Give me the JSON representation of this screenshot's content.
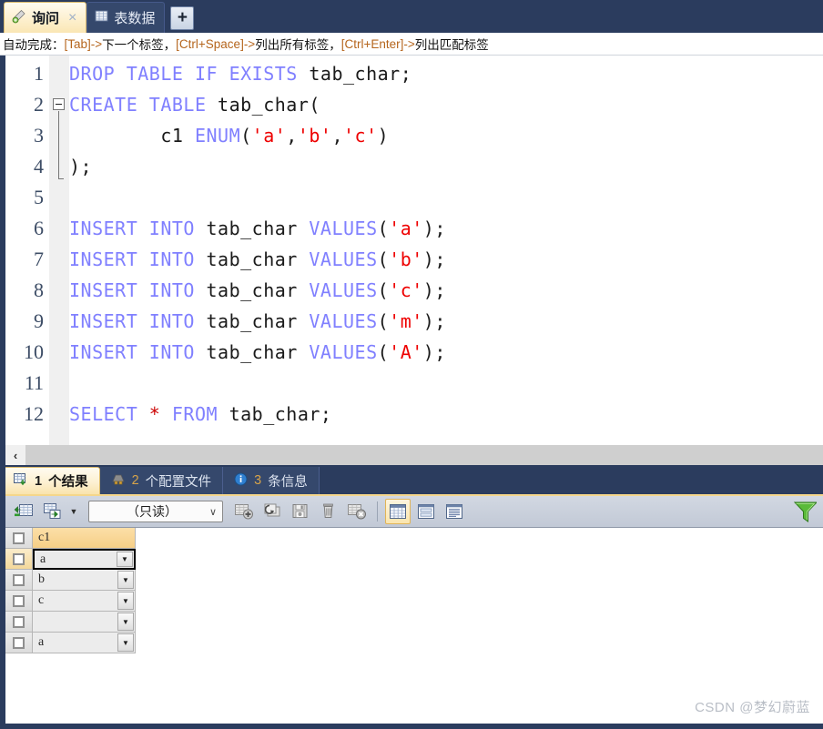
{
  "window": {
    "accent_gold": "#f5d68a",
    "chrome_navy": "#2b3c5e"
  },
  "tabs": [
    {
      "label": "询问",
      "icon": "query-tab-icon",
      "active": true,
      "closable": true,
      "close_glyph": "×"
    },
    {
      "label": "表数据",
      "icon": "table-data-icon",
      "active": false,
      "closable": false
    }
  ],
  "new_tab_button": {
    "label": "+",
    "name": "new-tab-button"
  },
  "hint": {
    "prefix": "自动完成：",
    "items": [
      {
        "key": "[Tab]->",
        "text": " 下一个标签，"
      },
      {
        "key": "[Ctrl+Space]->",
        "text": " 列出所有标签，"
      },
      {
        "key": "[Ctrl+Enter]->",
        "text": " 列出匹配标签"
      }
    ]
  },
  "editor": {
    "lines": [
      {
        "n": "1",
        "tokens": [
          {
            "t": "DROP TABLE IF EXISTS ",
            "c": "kw"
          },
          {
            "t": "tab_char",
            "c": "id"
          },
          {
            "t": ";",
            "c": "pun"
          }
        ]
      },
      {
        "n": "2",
        "tokens": [
          {
            "t": "CREATE TABLE ",
            "c": "kw"
          },
          {
            "t": "tab_char",
            "c": "id"
          },
          {
            "t": "(",
            "c": "pun"
          }
        ]
      },
      {
        "n": "3",
        "tokens": [
          {
            "t": "        c1 ",
            "c": "id"
          },
          {
            "t": "ENUM",
            "c": "kw"
          },
          {
            "t": "(",
            "c": "pun"
          },
          {
            "t": "'a'",
            "c": "str"
          },
          {
            "t": ",",
            "c": "pun"
          },
          {
            "t": "'b'",
            "c": "str"
          },
          {
            "t": ",",
            "c": "pun"
          },
          {
            "t": "'c'",
            "c": "str"
          },
          {
            "t": ")",
            "c": "pun"
          }
        ]
      },
      {
        "n": "4",
        "tokens": [
          {
            "t": ");",
            "c": "pun"
          }
        ]
      },
      {
        "n": "5",
        "tokens": []
      },
      {
        "n": "6",
        "tokens": [
          {
            "t": "INSERT INTO ",
            "c": "kw"
          },
          {
            "t": "tab_char ",
            "c": "id"
          },
          {
            "t": "VALUES",
            "c": "kw"
          },
          {
            "t": "(",
            "c": "pun"
          },
          {
            "t": "'a'",
            "c": "str"
          },
          {
            "t": ");",
            "c": "pun"
          }
        ]
      },
      {
        "n": "7",
        "tokens": [
          {
            "t": "INSERT INTO ",
            "c": "kw"
          },
          {
            "t": "tab_char ",
            "c": "id"
          },
          {
            "t": "VALUES",
            "c": "kw"
          },
          {
            "t": "(",
            "c": "pun"
          },
          {
            "t": "'b'",
            "c": "str"
          },
          {
            "t": ");",
            "c": "pun"
          }
        ]
      },
      {
        "n": "8",
        "tokens": [
          {
            "t": "INSERT INTO ",
            "c": "kw"
          },
          {
            "t": "tab_char ",
            "c": "id"
          },
          {
            "t": "VALUES",
            "c": "kw"
          },
          {
            "t": "(",
            "c": "pun"
          },
          {
            "t": "'c'",
            "c": "str"
          },
          {
            "t": ");",
            "c": "pun"
          }
        ]
      },
      {
        "n": "9",
        "tokens": [
          {
            "t": "INSERT INTO ",
            "c": "kw"
          },
          {
            "t": "tab_char ",
            "c": "id"
          },
          {
            "t": "VALUES",
            "c": "kw"
          },
          {
            "t": "(",
            "c": "pun"
          },
          {
            "t": "'m'",
            "c": "str"
          },
          {
            "t": ");",
            "c": "pun"
          }
        ]
      },
      {
        "n": "10",
        "tokens": [
          {
            "t": "INSERT INTO ",
            "c": "kw"
          },
          {
            "t": "tab_char ",
            "c": "id"
          },
          {
            "t": "VALUES",
            "c": "kw"
          },
          {
            "t": "(",
            "c": "pun"
          },
          {
            "t": "'A'",
            "c": "str"
          },
          {
            "t": ");",
            "c": "pun"
          }
        ]
      },
      {
        "n": "11",
        "tokens": []
      },
      {
        "n": "12",
        "tokens": [
          {
            "t": "SELECT ",
            "c": "kw"
          },
          {
            "t": "*",
            "c": "op"
          },
          {
            "t": " FROM ",
            "c": "kw"
          },
          {
            "t": "tab_char",
            "c": "id"
          },
          {
            "t": ";",
            "c": "pun"
          }
        ]
      }
    ],
    "fold_marker": {
      "line": "2",
      "glyph": "-",
      "collapsed": false
    }
  },
  "hscrollbar": {
    "left_arrow": "‹"
  },
  "result_tabs": [
    {
      "num": "1",
      "label": "个结果",
      "icon": "result-grid-icon",
      "active": true
    },
    {
      "num": "2",
      "label": "个配置文件",
      "icon": "profile-icon",
      "active": false
    },
    {
      "num": "3",
      "label": "条信息",
      "icon": "info-icon",
      "active": false
    }
  ],
  "grid_toolbar": {
    "buttons": [
      {
        "name": "import-grid-button",
        "icon": "import-grid-icon",
        "enabled": true
      },
      {
        "name": "export-grid-button",
        "icon": "export-grid-icon",
        "enabled": true
      }
    ],
    "dropdown_chevron": "▼",
    "mode_select": {
      "value": "（只读）",
      "arrow": "∨",
      "name": "edit-mode-select"
    },
    "record_buttons": [
      {
        "name": "add-record-button",
        "icon": "add-record-icon",
        "enabled": false
      },
      {
        "name": "refresh-record-button",
        "icon": "refresh-record-icon",
        "enabled": false
      },
      {
        "name": "save-record-button",
        "icon": "save-floppy-icon",
        "enabled": false
      },
      {
        "name": "delete-record-button",
        "icon": "trash-icon",
        "enabled": false
      },
      {
        "name": "cancel-edit-button",
        "icon": "cancel-record-icon",
        "enabled": false
      }
    ],
    "view_buttons": [
      {
        "name": "grid-view-button",
        "icon": "grid-view-icon",
        "active": true
      },
      {
        "name": "form-view-button",
        "icon": "form-view-icon",
        "active": false
      },
      {
        "name": "text-view-button",
        "icon": "text-view-icon",
        "active": false
      }
    ],
    "filter_button": {
      "name": "filter-button",
      "icon": "funnel-icon",
      "color": "#5aba3a"
    }
  },
  "grid": {
    "columns": [
      "c1"
    ],
    "rows": [
      {
        "values": [
          "a"
        ],
        "selected": true
      },
      {
        "values": [
          "b"
        ],
        "selected": false
      },
      {
        "values": [
          "c"
        ],
        "selected": false
      },
      {
        "values": [
          ""
        ],
        "selected": false
      },
      {
        "values": [
          "a"
        ],
        "selected": false
      }
    ],
    "cell_arrow": "▼"
  },
  "watermark": {
    "text": "CSDN @梦幻蔚蓝"
  }
}
